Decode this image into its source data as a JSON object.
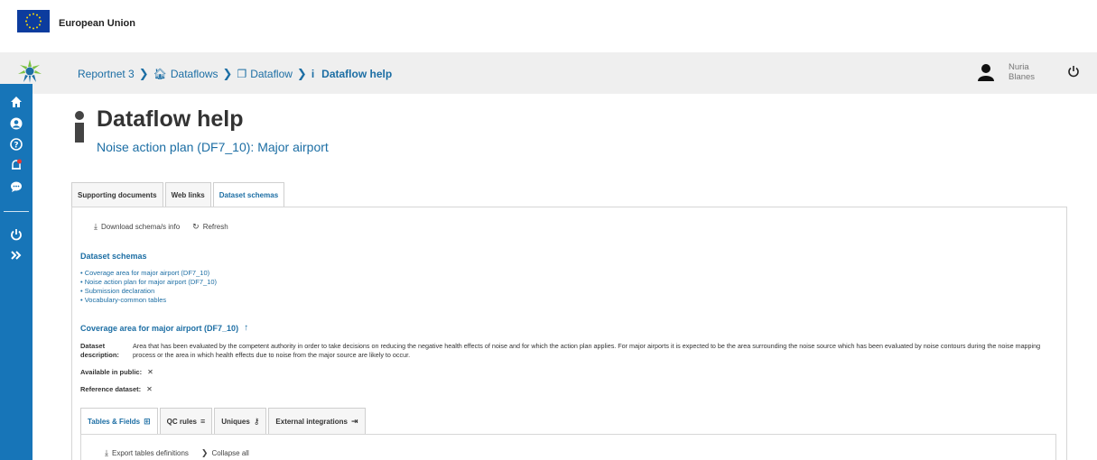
{
  "eu": {
    "title": "European Union"
  },
  "breadcrumb": {
    "items": [
      {
        "label": "Reportnet 3",
        "icon": ""
      },
      {
        "label": "Dataflows",
        "icon": "home-icon"
      },
      {
        "label": "Dataflow",
        "icon": "clone-icon"
      },
      {
        "label": "Dataflow help",
        "icon": "info-icon"
      }
    ]
  },
  "user": {
    "first": "Nuria",
    "last": "Blanes"
  },
  "page": {
    "title": "Dataflow help",
    "subtitle": "Noise action plan (DF7_10): Major airport"
  },
  "tabs": [
    {
      "label": "Supporting documents",
      "active": false
    },
    {
      "label": "Web links",
      "active": false
    },
    {
      "label": "Dataset schemas",
      "active": true
    }
  ],
  "toolbar": {
    "download": "Download schema/s info",
    "refresh": "Refresh"
  },
  "schemas": {
    "section_title": "Dataset schemas",
    "items": [
      "Coverage area for major airport (DF7_10)",
      "Noise action plan for major airport (DF7_10)",
      "Submission declaration",
      "Vocabulary-common tables"
    ],
    "heading": "Coverage area for major airport (DF7_10)",
    "desc_label_1": "Dataset",
    "desc_label_2": "description:",
    "desc_text": "Area that has been evaluated by the competent authority in order to take decisions on reducing the negative health effects of noise and for which the action plan applies. For major airports it is expected to be the area surrounding the noise source which has been evaluated by noise contours during the noise mapping process or the area in which health effects due to noise from the major source are likely to occur.",
    "available_label": "Available in public:",
    "reference_label": "Reference dataset:"
  },
  "inner_tabs": [
    {
      "label": "Tables & Fields",
      "icon": "table-icon",
      "glyph": "⊞",
      "active": true
    },
    {
      "label": "QC rules",
      "icon": "list-icon",
      "glyph": "≡",
      "active": false
    },
    {
      "label": "Uniques",
      "icon": "key-icon",
      "glyph": "⚷",
      "active": false
    },
    {
      "label": "External integrations",
      "icon": "sign-in-icon",
      "glyph": "⇥",
      "active": false
    }
  ],
  "inner_toolbar": {
    "export": "Export tables definitions",
    "collapse": "Collapse all"
  },
  "colors": {
    "primary": "#1775b8",
    "link": "#1c6ea4",
    "header_bg": "#efefef"
  }
}
